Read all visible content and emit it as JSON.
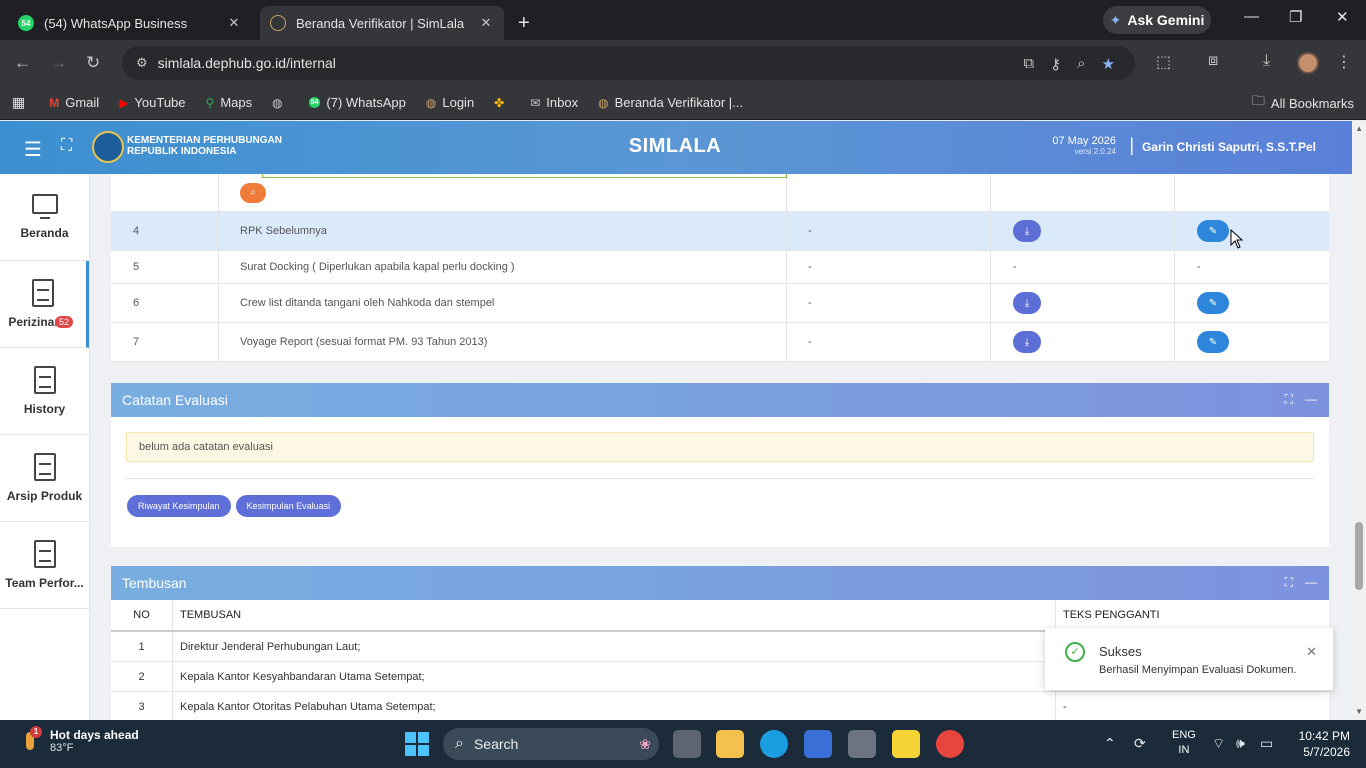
{
  "browser": {
    "tabs": [
      {
        "title": "(54) WhatsApp Business",
        "badge": "54"
      },
      {
        "title": "Beranda Verifikator | SimLala"
      }
    ],
    "gemini_label": "Ask Gemini",
    "url": "simlala.dephub.go.id/internal",
    "bookmarks": [
      {
        "label": "Gmail",
        "icon": "gmail-icon"
      },
      {
        "label": "YouTube",
        "icon": "youtube-icon"
      },
      {
        "label": "Maps",
        "icon": "maps-icon"
      },
      {
        "label": "",
        "icon": "globe-icon"
      },
      {
        "label": "(7) WhatsApp",
        "icon": "whatsapp-icon",
        "badge": "54"
      },
      {
        "label": "Login",
        "icon": "globe-icon"
      },
      {
        "label": "",
        "icon": "pinwheel-icon"
      },
      {
        "label": "Inbox",
        "icon": "inbox-icon"
      },
      {
        "label": "Beranda Verifikator |...",
        "icon": "globe-icon"
      }
    ],
    "all_bookmarks": "All Bookmarks"
  },
  "header": {
    "ministry_line1": "KEMENTERIAN PERHUBUNGAN",
    "ministry_line2": "REPUBLIK INDONESIA",
    "app_title": "SIMLALA",
    "date": "07 May 2026",
    "version": "versi 2.0.24",
    "separator": "|",
    "user": "Garin Christi Saputri, S.S.T.Pel"
  },
  "sidebar": {
    "items": [
      {
        "label": "Beranda"
      },
      {
        "label": "Perizinan",
        "badge": "52"
      },
      {
        "label": "History"
      },
      {
        "label": "Arsip Produk"
      },
      {
        "label": "Team Perfor..."
      }
    ]
  },
  "documents": {
    "rows": [
      {
        "no": "4",
        "name": "RPK Sebelumnya",
        "v1": "-",
        "v2": "",
        "v3": ""
      },
      {
        "no": "5",
        "name": "Surat Docking ( Diperlukan apabila kapal perlu docking )",
        "v1": "-",
        "v2": "-",
        "v3": "-"
      },
      {
        "no": "6",
        "name": "Crew list ditanda tangani oleh Nahkoda dan stempel",
        "v1": "-",
        "v2": "",
        "v3": ""
      },
      {
        "no": "7",
        "name": "Voyage Report (sesuai format PM. 93 Tahun 2013)",
        "v1": "-",
        "v2": "",
        "v3": ""
      }
    ]
  },
  "evaluation": {
    "title": "Catatan Evaluasi",
    "note": "belum ada catatan evaluasi",
    "buttons": [
      "Riwayat Kesimpulan",
      "Kesimpulan Evaluasi"
    ]
  },
  "tembusan": {
    "title": "Tembusan",
    "headers": [
      "NO",
      "TEMBUSAN",
      "TEKS PENGGANTI"
    ],
    "rows": [
      {
        "no": "1",
        "tembusan": "Direktur Jenderal Perhubungan Laut;",
        "pengganti": ""
      },
      {
        "no": "2",
        "tembusan": "Kepala Kantor Kesyahbandaran Utama Setempat;",
        "pengganti": ""
      },
      {
        "no": "3",
        "tembusan": "Kepala Kantor Otoritas Pelabuhan Utama Setempat;",
        "pengganti": "-"
      }
    ]
  },
  "toast": {
    "title": "Sukses",
    "message": "Berhasil Menyimpan Evaluasi Dokumen."
  },
  "taskbar": {
    "weather_title": "Hot days ahead",
    "weather_temp": "83°F",
    "weather_alert": "1",
    "search_label": "Search",
    "lang_line1": "ENG",
    "lang_line2": "IN",
    "time": "10:42 PM",
    "date": "5/7/2026"
  },
  "colors": {
    "header_gradient_start": "#3b8fd0",
    "header_gradient_end": "#5a7fd8",
    "button_download": "#5c6fd6",
    "button_edit": "#2d86d9",
    "success": "#3fb24a"
  }
}
